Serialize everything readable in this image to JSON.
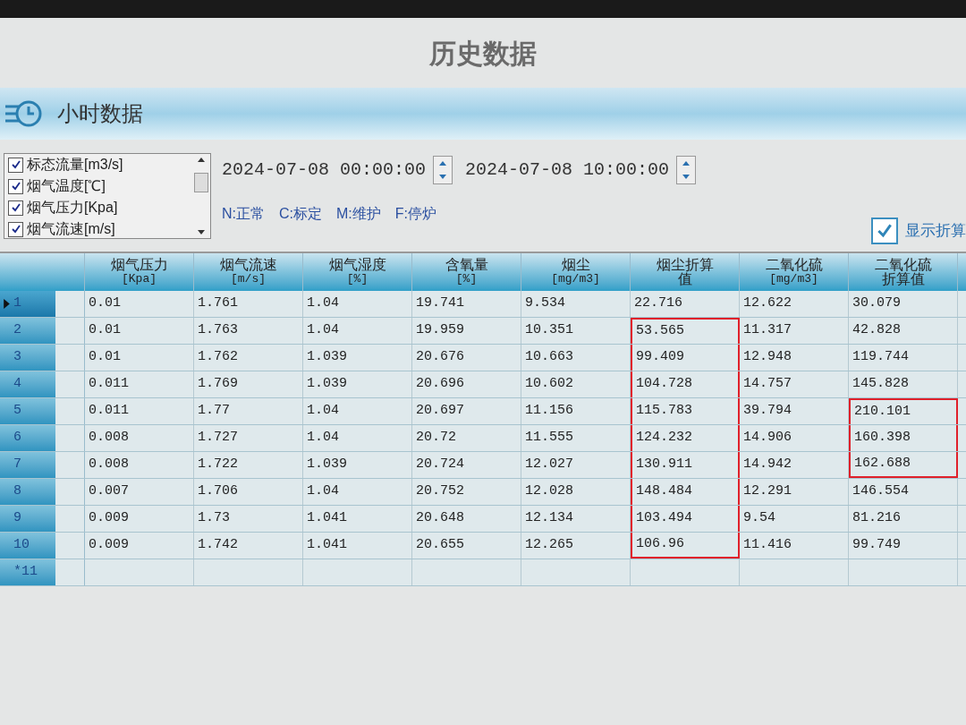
{
  "window": {
    "title": "历史数据"
  },
  "section": {
    "title": "小时数据"
  },
  "parameters": [
    {
      "label": "标态流量[m3/s]",
      "checked": true
    },
    {
      "label": "烟气温度[℃]",
      "checked": true
    },
    {
      "label": "烟气压力[Kpa]",
      "checked": true
    },
    {
      "label": "烟气流速[m/s]",
      "checked": true
    }
  ],
  "start_time": {
    "value": "2024-07-08 00:00:00"
  },
  "end_time": {
    "value": "2024-07-08 10:00:00"
  },
  "legend": [
    "N:正常",
    "C:标定",
    "M:维护",
    "F:停炉"
  ],
  "show_converted": {
    "label": "显示折算",
    "checked": true
  },
  "table": {
    "columns": [
      {
        "name": "烟气压力",
        "unit": "[Kpa]"
      },
      {
        "name": "烟气流速",
        "unit": "[m/s]"
      },
      {
        "name": "烟气湿度",
        "unit": "[%]"
      },
      {
        "name": "含氧量",
        "unit": "[%]"
      },
      {
        "name": "烟尘",
        "unit": "[mg/m3]"
      },
      {
        "name": "烟尘折算值"
      },
      {
        "name": "二氧化硫",
        "unit": "[mg/m3]"
      },
      {
        "name": "二氧化硫折算值"
      }
    ],
    "rows": [
      {
        "header": "1",
        "selected": true,
        "cells": [
          {
            "text": "0.01",
            "highlighted": false
          },
          {
            "text": "1.761",
            "highlighted": false
          },
          {
            "text": "1.04",
            "highlighted": false
          },
          {
            "text": "19.741",
            "highlighted": false
          },
          {
            "text": "9.534",
            "highlighted": false
          },
          {
            "text": "22.716",
            "highlighted": false
          },
          {
            "text": "12.622",
            "highlighted": false
          },
          {
            "text": "30.079",
            "highlighted": false
          }
        ]
      },
      {
        "header": "2",
        "selected": false,
        "cells": [
          {
            "text": "0.01",
            "highlighted": false
          },
          {
            "text": "1.763",
            "highlighted": false
          },
          {
            "text": "1.04",
            "highlighted": false
          },
          {
            "text": "19.959",
            "highlighted": false
          },
          {
            "text": "10.351",
            "highlighted": false
          },
          {
            "text": "53.565",
            "highlighted": true
          },
          {
            "text": "11.317",
            "highlighted": false
          },
          {
            "text": "42.828",
            "highlighted": false
          }
        ]
      },
      {
        "header": "3",
        "selected": false,
        "cells": [
          {
            "text": "0.01",
            "highlighted": false
          },
          {
            "text": "1.762",
            "highlighted": false
          },
          {
            "text": "1.039",
            "highlighted": false
          },
          {
            "text": "20.676",
            "highlighted": false
          },
          {
            "text": "10.663",
            "highlighted": false
          },
          {
            "text": "99.409",
            "highlighted": true
          },
          {
            "text": "12.948",
            "highlighted": false
          },
          {
            "text": "119.744",
            "highlighted": false
          }
        ]
      },
      {
        "header": "4",
        "selected": false,
        "cells": [
          {
            "text": "0.011",
            "highlighted": false
          },
          {
            "text": "1.769",
            "highlighted": false
          },
          {
            "text": "1.039",
            "highlighted": false
          },
          {
            "text": "20.696",
            "highlighted": false
          },
          {
            "text": "10.602",
            "highlighted": false
          },
          {
            "text": "104.728",
            "highlighted": true
          },
          {
            "text": "14.757",
            "highlighted": false
          },
          {
            "text": "145.828",
            "highlighted": false
          }
        ]
      },
      {
        "header": "5",
        "selected": false,
        "cells": [
          {
            "text": "0.011",
            "highlighted": false
          },
          {
            "text": "1.77",
            "highlighted": false
          },
          {
            "text": "1.04",
            "highlighted": false
          },
          {
            "text": "20.697",
            "highlighted": false
          },
          {
            "text": "11.156",
            "highlighted": false
          },
          {
            "text": "115.783",
            "highlighted": true
          },
          {
            "text": "39.794",
            "highlighted": false
          },
          {
            "text": "210.101",
            "highlighted": true
          }
        ]
      },
      {
        "header": "6",
        "selected": false,
        "cells": [
          {
            "text": "0.008",
            "highlighted": false
          },
          {
            "text": "1.727",
            "highlighted": false
          },
          {
            "text": "1.04",
            "highlighted": false
          },
          {
            "text": "20.72",
            "highlighted": false
          },
          {
            "text": "11.555",
            "highlighted": false
          },
          {
            "text": "124.232",
            "highlighted": true
          },
          {
            "text": "14.906",
            "highlighted": false
          },
          {
            "text": "160.398",
            "highlighted": true
          }
        ]
      },
      {
        "header": "7",
        "selected": false,
        "cells": [
          {
            "text": "0.008",
            "highlighted": false
          },
          {
            "text": "1.722",
            "highlighted": false
          },
          {
            "text": "1.039",
            "highlighted": false
          },
          {
            "text": "20.724",
            "highlighted": false
          },
          {
            "text": "12.027",
            "highlighted": false
          },
          {
            "text": "130.911",
            "highlighted": true
          },
          {
            "text": "14.942",
            "highlighted": false
          },
          {
            "text": "162.688",
            "highlighted": true
          }
        ]
      },
      {
        "header": "8",
        "selected": false,
        "cells": [
          {
            "text": "0.007",
            "highlighted": false
          },
          {
            "text": "1.706",
            "highlighted": false
          },
          {
            "text": "1.04",
            "highlighted": false
          },
          {
            "text": "20.752",
            "highlighted": false
          },
          {
            "text": "12.028",
            "highlighted": false
          },
          {
            "text": "148.484",
            "highlighted": true
          },
          {
            "text": "12.291",
            "highlighted": false
          },
          {
            "text": "146.554",
            "highlighted": false
          }
        ]
      },
      {
        "header": "9",
        "selected": false,
        "cells": [
          {
            "text": "0.009",
            "highlighted": false
          },
          {
            "text": "1.73",
            "highlighted": false
          },
          {
            "text": "1.041",
            "highlighted": false
          },
          {
            "text": "20.648",
            "highlighted": false
          },
          {
            "text": "12.134",
            "highlighted": false
          },
          {
            "text": "103.494",
            "highlighted": true
          },
          {
            "text": "9.54",
            "highlighted": false
          },
          {
            "text": "81.216",
            "highlighted": false
          }
        ]
      },
      {
        "header": "10",
        "selected": false,
        "cells": [
          {
            "text": "0.009",
            "highlighted": false
          },
          {
            "text": "1.742",
            "highlighted": false
          },
          {
            "text": "1.041",
            "highlighted": false
          },
          {
            "text": "20.655",
            "highlighted": false
          },
          {
            "text": "12.265",
            "highlighted": false
          },
          {
            "text": "106.96",
            "highlighted": true
          },
          {
            "text": "11.416",
            "highlighted": false
          },
          {
            "text": "99.749",
            "highlighted": false
          }
        ]
      },
      {
        "header": "*11",
        "selected": false,
        "cells": []
      }
    ]
  }
}
